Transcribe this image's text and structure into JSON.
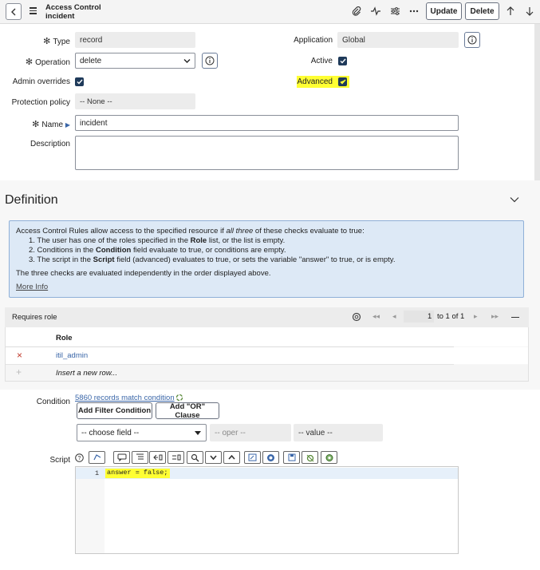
{
  "header": {
    "title_line1": "Access Control",
    "title_line2": "incident",
    "update_label": "Update",
    "delete_label": "Delete"
  },
  "form": {
    "type_label": "Type",
    "type_value": "record",
    "application_label": "Application",
    "application_value": "Global",
    "operation_label": "Operation",
    "operation_value": "delete",
    "active_label": "Active",
    "admin_overrides_label": "Admin overrides",
    "advanced_label": "Advanced",
    "protection_policy_label": "Protection policy",
    "protection_policy_value": "-- None --",
    "name_label": "Name",
    "name_value": "incident",
    "description_label": "Description"
  },
  "definition": {
    "title": "Definition",
    "intro_before": "Access Control Rules allow access to the specified resource if ",
    "intro_italic": "all three",
    "intro_after": " of these checks evaluate to true:",
    "item1_before": "1. The user has one of the roles specified in the ",
    "item1_bold": "Role",
    "item1_after": " list, or the list is empty.",
    "item2_before": "2. Conditions in the ",
    "item2_bold": "Condition",
    "item2_after": " field evaluate to true, or conditions are empty.",
    "item3_before": "3. The script in the ",
    "item3_bold": "Script",
    "item3_after": " field (advanced) evaluates to true, or sets the variable \"answer\" to true, or is empty.",
    "independent": "The three checks are evaluated independently in the order displayed above.",
    "more_info": "More Info"
  },
  "roles": {
    "header": "Requires role",
    "pagination": "to 1 of 1",
    "page_value": "1",
    "column": "Role",
    "rows": [
      "itil_admin"
    ],
    "insert_row": "Insert a new row..."
  },
  "condition": {
    "label": "Condition",
    "records_link": "5860 records match condition",
    "add_filter": "Add Filter Condition",
    "add_or": "Add \"OR\" Clause",
    "choose_field": "-- choose field --",
    "oper": "-- oper --",
    "value": "-- value --"
  },
  "script": {
    "label": "Script",
    "line_number": "1",
    "code": "answer = false;"
  },
  "colors": {
    "highlight": "#ffff33",
    "checkbox": "#1f3a5a",
    "link": "#3a66a8",
    "info_bg": "#dde9f6"
  }
}
